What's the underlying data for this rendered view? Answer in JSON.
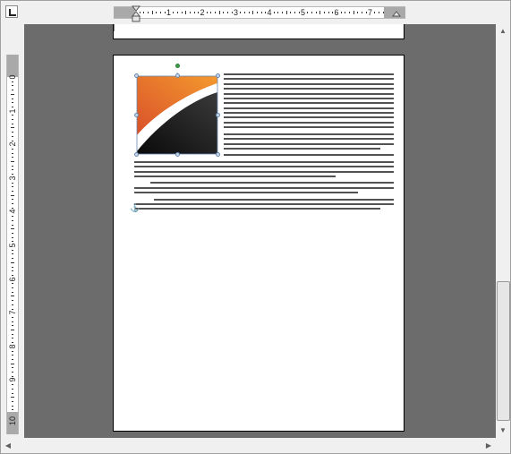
{
  "rulers": {
    "tab_selector_icon": "left-tab-icon",
    "horizontal_labels": [
      "1",
      "2",
      "3",
      "4",
      "5",
      "6",
      "7"
    ],
    "vertical_labels": [
      "1",
      "1",
      "2",
      "3",
      "4",
      "5",
      "6",
      "7",
      "8",
      "9",
      "10"
    ],
    "vertical_zero_label": "0"
  },
  "picture": {
    "name": "Gradient shape picture",
    "colors": {
      "orange_light": "#f49a2e",
      "orange_dark": "#d9502a",
      "dark_top": "#3a3a3a",
      "dark_bottom": "#0a0a0a",
      "swoosh": "#ffffff"
    }
  },
  "document": {
    "paragraphs": [
      {
        "text": "for it.' 'And the horse?' 'I gave a lump of silver as big as my head for it.' 'And the ... years.' 'You have thriven well in the world hitherto,' said the grinder; 'now if you ... you put your hand in it, your fortune would be made.' 'Very true: but how is that to ... grinder like myself,' said the other; 'you only want a grindstone; the rest will come of ... for which I would not ask more than the value of your goose for it: will you buy?' ... the happiest man in the world! If I could have money whenever I put my hand in my ... goose.' 'Now,' said the grinder, as he gave him a common rough stone that lay by ... work it well enough, and you can make an old nail cut with it.'",
        "lines": 12
      },
      {
        "text": "... way, with a light heart; his eyes sparkled for joy, and he said to himself 'Surely, I ... thing I could want or wish for comes of itself. People are so kind; they seem really to ... be rich, and giving me good bargains.'",
        "lines": 4
      },
      {
        "text": "... and hungry, too, for he had given away his last penny in his joy at getting the cow.",
        "lines": 1
      },
      {
        "text": "... stone tired him sadly: and he dragged himself to the side of a river, that he might take a drink of water, and rest a while. So he laid the stone carefully by his side on the bank: but, as he stooped down to drink, he forgot it, pushed it a little, and down it rolled, plump into the stream.",
        "lines": 4
      },
      {
        "text": "For a while he watched it sinking in the deep clear water; then sprang up and danced for joy, and again fell upon his knees and thanked Heaven, with tears in his eyes, for its kindness in taking away his only plague, the ugly heavy stone.",
        "lines": 3
      },
      {
        "text": "'How happy am I!' cried he; 'nobody was ever so lucky as I.' Then up he got with a light heart, free from all his troubles, and walked on till he reached his mother's house, and told her how very easy the road to good luck was.",
        "lines": 3
      }
    ],
    "anchor_icon": "anchor-icon"
  },
  "scrollbars": {
    "up_arrow": "▲",
    "down_arrow": "▼",
    "left_arrow": "◀",
    "right_arrow": "▶"
  }
}
